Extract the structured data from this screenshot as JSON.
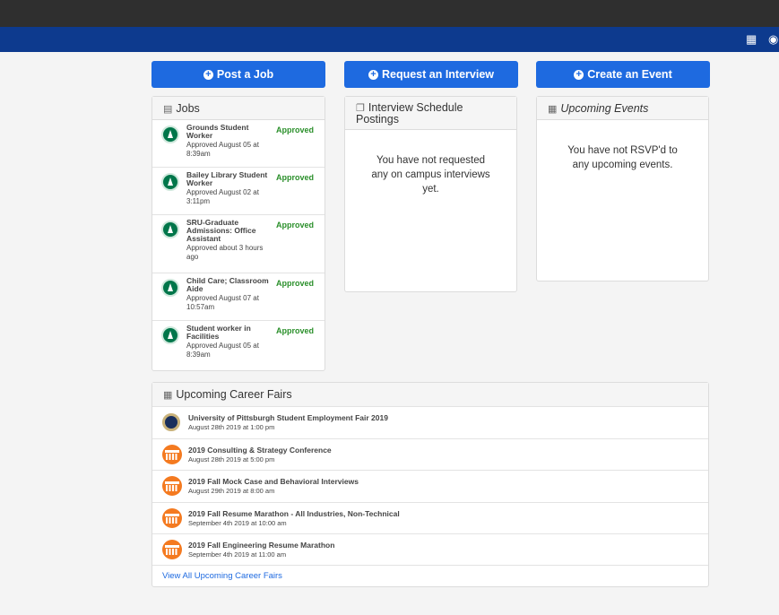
{
  "actions": {
    "post_job": "Post a Job",
    "request_interview": "Request an Interview",
    "create_event": "Create an Event"
  },
  "jobs_panel": {
    "title": "Jobs",
    "items": [
      {
        "title": "Grounds Student Worker",
        "approved": "Approved August 05 at 8:39am",
        "status": "Approved"
      },
      {
        "title": "Bailey Library Student Worker",
        "approved": "Approved August 02 at 3:11pm",
        "status": "Approved"
      },
      {
        "title": "SRU-Graduate Admissions: Office Assistant",
        "approved": "Approved about 3 hours ago",
        "status": "Approved"
      },
      {
        "title": "Child Care; Classroom Aide",
        "approved": "Approved August 07 at 10:57am",
        "status": "Approved"
      },
      {
        "title": "Student worker in Facilities",
        "approved": "Approved August 05 at 8:39am",
        "status": "Approved"
      }
    ]
  },
  "interview_panel": {
    "title": "Interview Schedule Postings",
    "empty": "You have not requested any on campus interviews yet."
  },
  "events_panel": {
    "title": "Upcoming Events",
    "empty": "You have not RSVP'd to any upcoming events."
  },
  "career_fairs": {
    "title": "Upcoming Career Fairs",
    "items": [
      {
        "title": "University of Pittsburgh Student Employment Fair 2019",
        "date": "August 28th 2019 at 1:00 pm",
        "logo": "pitt-seal"
      },
      {
        "title": "2019 Consulting & Strategy Conference",
        "date": "August 28th 2019 at 5:00 pm",
        "logo": "uva-rotunda"
      },
      {
        "title": "2019 Fall Mock Case and Behavioral Interviews",
        "date": "August 29th 2019 at 8:00 am",
        "logo": "uva-rotunda"
      },
      {
        "title": "2019 Fall Resume Marathon - All Industries, Non-Technical",
        "date": "September 4th 2019 at 10:00 am",
        "logo": "uva-rotunda"
      },
      {
        "title": "2019 Fall Engineering Resume Marathon",
        "date": "September 4th 2019 at 11:00 am",
        "logo": "uva-rotunda"
      }
    ],
    "view_all": "View All Upcoming Career Fairs"
  },
  "colors": {
    "primary": "#1e6ae0",
    "nav": "#0d3a8e",
    "topbar": "#2f2f2f",
    "approved": "#2a8f2a"
  }
}
